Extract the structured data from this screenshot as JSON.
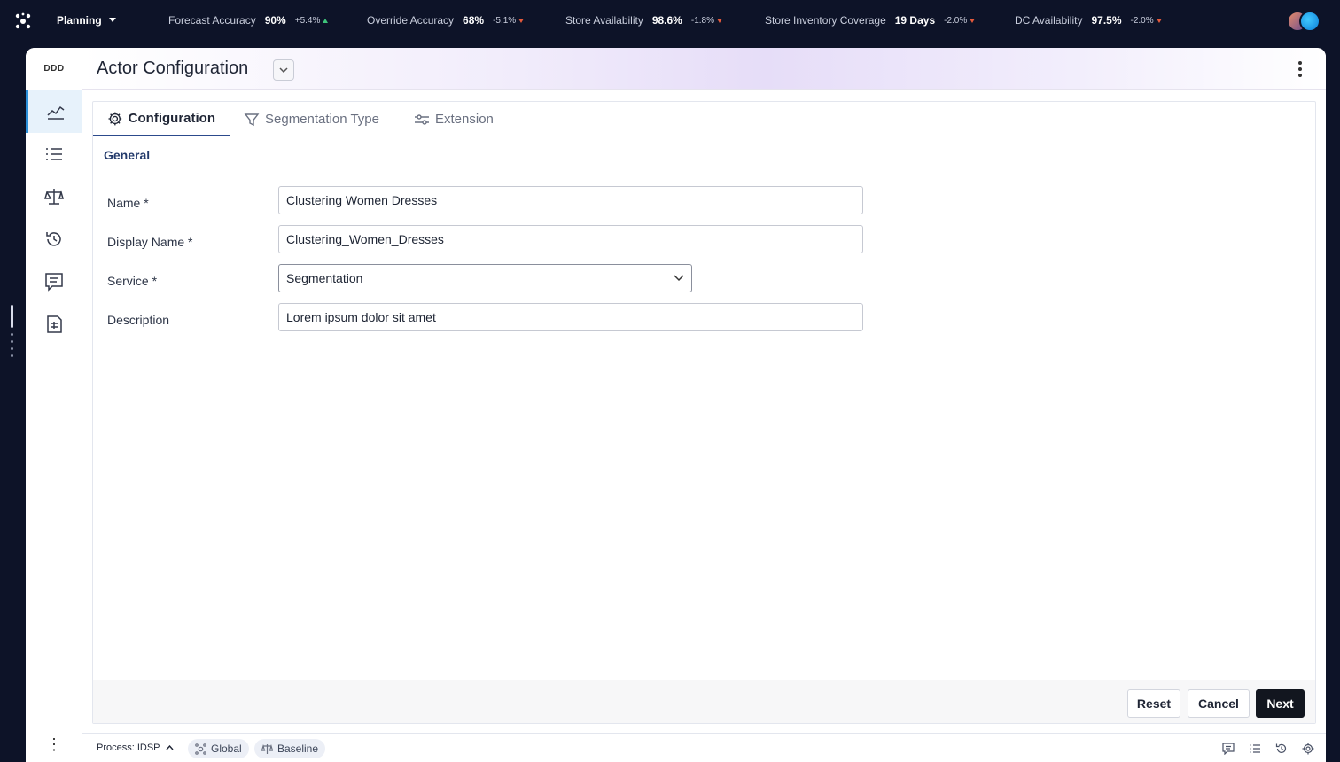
{
  "topbar": {
    "app_name": "Planning",
    "metrics": [
      {
        "label": "Forecast Accuracy",
        "value": "90%",
        "delta": "+5.4%",
        "trend": "up"
      },
      {
        "label": "Override Accuracy",
        "value": "68%",
        "delta": "-5.1%",
        "trend": "down"
      },
      {
        "label": "Store Availability",
        "value": "98.6%",
        "delta": "-1.8%",
        "trend": "down"
      },
      {
        "label": "Store Inventory Coverage",
        "value": "19 Days",
        "delta": "-2.0%",
        "trend": "down"
      },
      {
        "label": "DC Availability",
        "value": "97.5%",
        "delta": "-2.0%",
        "trend": "down"
      }
    ]
  },
  "sidebar": {
    "brand": "DDD",
    "items": [
      {
        "icon": "trend-chart-icon",
        "active": true
      },
      {
        "icon": "list-icon",
        "active": false
      },
      {
        "icon": "scale-icon",
        "active": false
      },
      {
        "icon": "history-icon",
        "active": false
      },
      {
        "icon": "comments-icon",
        "active": false
      },
      {
        "icon": "report-icon",
        "active": false
      }
    ]
  },
  "header": {
    "title": "Actor Configuration"
  },
  "tabs": [
    {
      "label": "Configuration",
      "icon": "gear-icon",
      "active": true
    },
    {
      "label": "Segmentation Type",
      "icon": "filter-icon",
      "active": false
    },
    {
      "label": "Extension",
      "icon": "sliders-icon",
      "active": false
    }
  ],
  "form": {
    "section_title": "General",
    "name_label": "Name *",
    "name_value": "Clustering Women Dresses",
    "display_name_label": "Display Name *",
    "display_name_value": "Clustering_Women_Dresses",
    "service_label": "Service *",
    "service_value": "Segmentation",
    "description_label": "Description",
    "description_value": "Lorem ipsum dolor sit amet"
  },
  "actions": {
    "reset": "Reset",
    "cancel": "Cancel",
    "next": "Next"
  },
  "bottom_bar": {
    "process_label": "Process: IDSP",
    "chips": [
      "Global",
      "Baseline"
    ]
  },
  "colors": {
    "accent": "#2c90d9",
    "primary_button": "#12161f",
    "topbar_bg": "#0d1328",
    "up": "#3ec47a",
    "down": "#e55a3c"
  }
}
